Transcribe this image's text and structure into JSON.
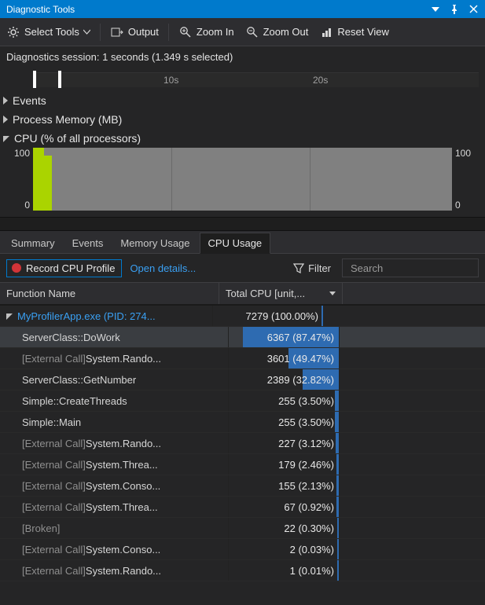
{
  "title": "Diagnostic Tools",
  "toolbar": {
    "select_tools": "Select Tools",
    "output": "Output",
    "zoom_in": "Zoom In",
    "zoom_out": "Zoom Out",
    "reset_view": "Reset View"
  },
  "session": {
    "label": "Diagnostics session: 1 seconds (1.349 s selected)",
    "ticks": [
      "10s",
      "20s"
    ]
  },
  "sections": {
    "events": "Events",
    "process_memory": "Process Memory (MB)",
    "cpu": "CPU (% of all processors)"
  },
  "chart_data": {
    "type": "area",
    "title": "CPU (% of all processors)",
    "ylabel": "%",
    "ylim": [
      0,
      100
    ],
    "y_left_ticks": [
      "100",
      "0"
    ],
    "y_right_ticks": [
      "100",
      "0"
    ],
    "x_range_seconds": [
      0,
      30
    ],
    "series": [
      {
        "name": "CPU %",
        "x": [
          0,
          1.35,
          1.36,
          30
        ],
        "values": [
          100,
          100,
          0,
          0
        ]
      }
    ],
    "selection_seconds": [
      0,
      1.349
    ]
  },
  "tabs": {
    "summary": "Summary",
    "events": "Events",
    "memory_usage": "Memory Usage",
    "cpu_usage": "CPU Usage"
  },
  "cpu_toolbar": {
    "record": "Record CPU Profile",
    "open_details": "Open details...",
    "filter": "Filter",
    "search_placeholder": "Search"
  },
  "columns": {
    "function_name": "Function Name",
    "total_cpu": "Total CPU [unit,..."
  },
  "rows": [
    {
      "name": "MyProfilerApp.exe (PID: 274...",
      "value": "7279 (100.00%)",
      "is_parent": true,
      "ext": false,
      "heat": 0,
      "edge": 0
    },
    {
      "name": "ServerClass::DoWork",
      "value": "6367 (87.47%)",
      "ext": false,
      "heat": 87.47,
      "selected": true
    },
    {
      "name": "System.Rando...",
      "value": "3601 (49.47%)",
      "ext": true,
      "heat": 0,
      "edge": 49.47
    },
    {
      "name": "ServerClass::GetNumber",
      "value": "2389 (32.82%)",
      "ext": false,
      "heat": 32.82
    },
    {
      "name": "Simple::CreateThreads",
      "value": "255 (3.50%)",
      "ext": false,
      "heat": 0,
      "edge": 3.5
    },
    {
      "name": "Simple::Main",
      "value": "255 (3.50%)",
      "ext": false,
      "heat": 0,
      "edge": 3.5
    },
    {
      "name": "System.Rando...",
      "value": "227 (3.12%)",
      "ext": true,
      "heat": 0,
      "edge": 3.12
    },
    {
      "name": "System.Threa...",
      "value": "179 (2.46%)",
      "ext": true,
      "heat": 0,
      "edge": 2.46
    },
    {
      "name": "System.Conso...",
      "value": "155 (2.13%)",
      "ext": true,
      "heat": 0,
      "edge": 2.13
    },
    {
      "name": "System.Threa...",
      "value": "67 (0.92%)",
      "ext": true,
      "heat": 0,
      "edge": 2
    },
    {
      "name": "[Broken]",
      "value": "22 (0.30%)",
      "ext": false,
      "broken": true,
      "heat": 0,
      "edge": 1.5
    },
    {
      "name": "System.Conso...",
      "value": "2 (0.03%)",
      "ext": true,
      "heat": 0,
      "edge": 1.5
    },
    {
      "name": "System.Rando...",
      "value": "1 (0.01%)",
      "ext": true,
      "heat": 0,
      "edge": 1.5
    }
  ],
  "labels": {
    "external_call_prefix": "[External Call] "
  }
}
